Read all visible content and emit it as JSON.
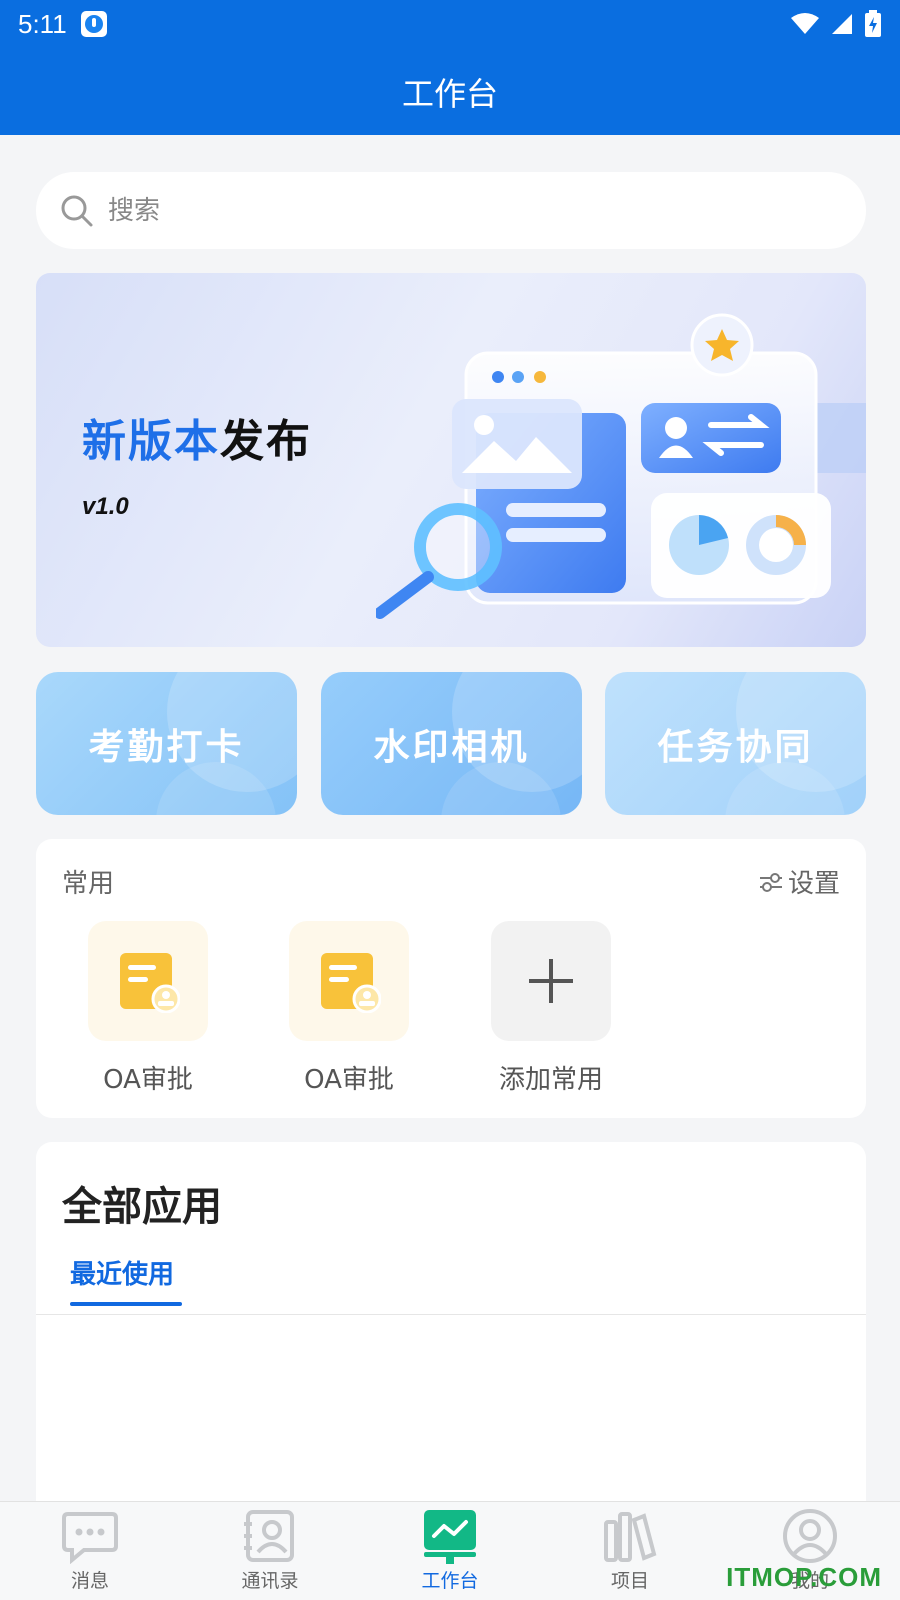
{
  "status_bar": {
    "time": "5:11"
  },
  "header": {
    "title": "工作台"
  },
  "search": {
    "placeholder": "搜索"
  },
  "banner": {
    "title_highlight": "新版本",
    "title_rest": "发布",
    "version": "v1.0"
  },
  "quick_actions": [
    {
      "label": "考勤打卡"
    },
    {
      "label": "水印相机"
    },
    {
      "label": "任务协同"
    }
  ],
  "common": {
    "title": "常用",
    "settings_label": "设置",
    "items": [
      {
        "label": "OA审批",
        "icon": "document-stamp-icon"
      },
      {
        "label": "OA审批",
        "icon": "document-stamp-icon"
      },
      {
        "label": "添加常用",
        "icon": "plus-icon"
      }
    ]
  },
  "all_apps": {
    "title": "全部应用",
    "tabs": [
      {
        "label": "最近使用",
        "active": true
      }
    ]
  },
  "bottom_nav": [
    {
      "label": "消息",
      "icon": "chat-icon"
    },
    {
      "label": "通讯录",
      "icon": "contacts-icon"
    },
    {
      "label": "工作台",
      "icon": "workbench-icon",
      "active": true
    },
    {
      "label": "项目",
      "icon": "books-icon"
    },
    {
      "label": "我的",
      "icon": "profile-icon"
    }
  ],
  "watermark": "ITMOP.COM",
  "colors": {
    "primary": "#0a6ee0",
    "accent": "#1169e0",
    "watermark": "#2a9d3a"
  }
}
